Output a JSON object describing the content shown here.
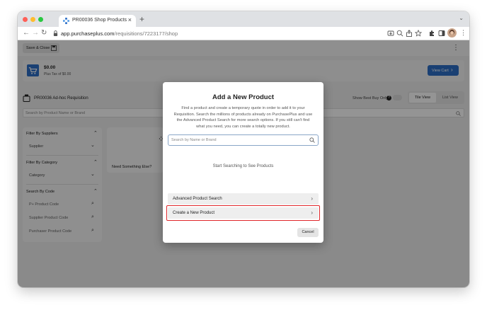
{
  "browser": {
    "tab_title": "PR00036 Shop Products",
    "tab_close": "×",
    "new_tab": "+",
    "url_host": "app.purchaseplus.com",
    "url_path": "/requisitions/7223177/shop",
    "icons": [
      "back-icon",
      "forward-icon",
      "reload-icon",
      "lock-icon",
      "install-icon",
      "zoom-icon",
      "share-icon",
      "bookmark-star-icon",
      "extensions-icon",
      "sidepanel-icon",
      "profile-avatar",
      "kebab-menu-icon"
    ]
  },
  "app": {
    "save_close_label": "Save & Close",
    "more_icon": "⋮",
    "cart_total": "$0.00",
    "cart_tax": "Plus Tax of $0.00",
    "view_cart_label": "View Cart",
    "requisition_title": "PR00036 Ad-hoc Requisition",
    "best_buy_label": "Show Best Buy Only",
    "tile_view_label": "Tile View",
    "list_view_label": "List View",
    "search_placeholder": "Search by Product Name or Brand",
    "filters": {
      "suppliers_title": "Filter By Suppliers",
      "supplier_select": "Supplier",
      "category_title": "Filter By Category",
      "category_select": "Category",
      "code_title": "Search By Code",
      "code_fields": [
        "P+ Product Code",
        "Supplier Product Code",
        "Purchaser Product Code"
      ]
    },
    "need_something_else": "Need Something Else?"
  },
  "modal": {
    "title": "Add a New Product",
    "description": "Find a product and create a temporary quote in order to add it to your Requisition. Search the millions of products already on PurchasePlus and use the Advanced Product Search for more search options. If you still can't find what you need, you can create a totally new product.",
    "search_placeholder": "Search by Name or Brand",
    "empty_state": "Start Searching to See Products",
    "advanced_search_label": "Advanced Product Search",
    "create_new_label": "Create a New Product",
    "cancel_label": "Cancel"
  },
  "colors": {
    "brand_blue": "#2d6fc7",
    "highlight_red": "#e0262a",
    "dim_overlay": "rgba(0,0,0,0.42)"
  }
}
